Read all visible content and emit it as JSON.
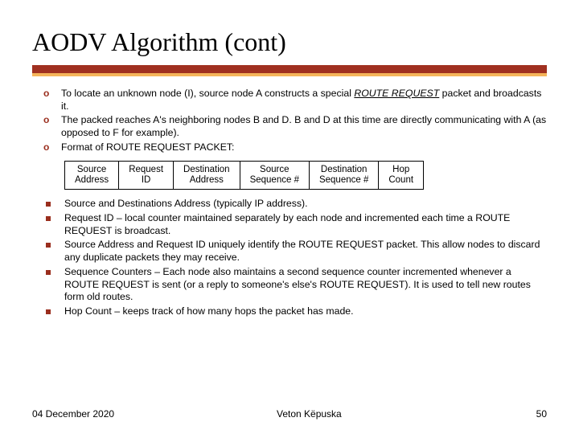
{
  "slide": {
    "title": "AODV Algorithm (cont)",
    "bullets": [
      {
        "pre": "To locate an unknown node (I), source node A constructs a special ",
        "em": "ROUTE REQUEST",
        "post": " packet and broadcasts it."
      },
      {
        "pre": "The packed reaches A's neighboring nodes B and D. B and D at this time are directly communicating with A (as opposed to F for example).",
        "em": "",
        "post": ""
      },
      {
        "pre": "Format of ROUTE REQUEST PACKET:",
        "em": "",
        "post": ""
      }
    ],
    "packet_fields": [
      {
        "l1": "Source",
        "l2": "Address"
      },
      {
        "l1": "Request",
        "l2": "ID"
      },
      {
        "l1": "Destination",
        "l2": "Address"
      },
      {
        "l1": "Source",
        "l2": "Sequence #"
      },
      {
        "l1": "Destination",
        "l2": "Sequence #"
      },
      {
        "l1": "Hop",
        "l2": "Count"
      }
    ],
    "sub_bullets": [
      "Source and Destinations Address (typically IP address).",
      "Request ID – local counter maintained separately by each node and incremented each time a ROUTE REQUEST is broadcast.",
      "Source Address and Request ID uniquely identify the ROUTE REQUEST packet. This allow nodes to discard any duplicate packets they may receive.",
      "Sequence Counters – Each node also maintains a second sequence counter incremented whenever a ROUTE REQUEST is sent (or a reply to someone's else's ROUTE REQUEST). It is used to tell new routes form old routes.",
      "Hop Count – keeps track of how many hops the packet has made."
    ],
    "footer": {
      "date": "04 December 2020",
      "author": "Veton Këpuska",
      "page": "50"
    }
  }
}
